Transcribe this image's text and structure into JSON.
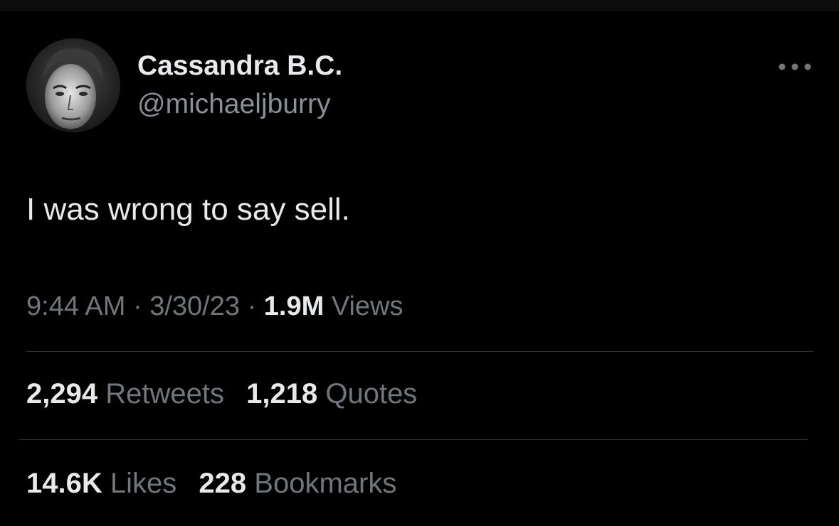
{
  "tweet": {
    "author": {
      "display_name": "Cassandra B.C.",
      "handle": "@michaeljburry"
    },
    "text": "I was wrong to say sell.",
    "time": "9:44 AM",
    "separator": "·",
    "date": "3/30/23",
    "views_count": "1.9M",
    "views_label": "Views"
  },
  "stats": {
    "retweets_count": "2,294",
    "retweets_label": "Retweets",
    "quotes_count": "1,218",
    "quotes_label": "Quotes",
    "likes_count": "14.6K",
    "likes_label": "Likes",
    "bookmarks_count": "228",
    "bookmarks_label": "Bookmarks"
  },
  "icons": {
    "more": "more-horizontal-icon"
  },
  "colors": {
    "background": "#000000",
    "primary_text": "#e7e9ea",
    "secondary_text": "#71767b",
    "divider": "#2f3336"
  }
}
